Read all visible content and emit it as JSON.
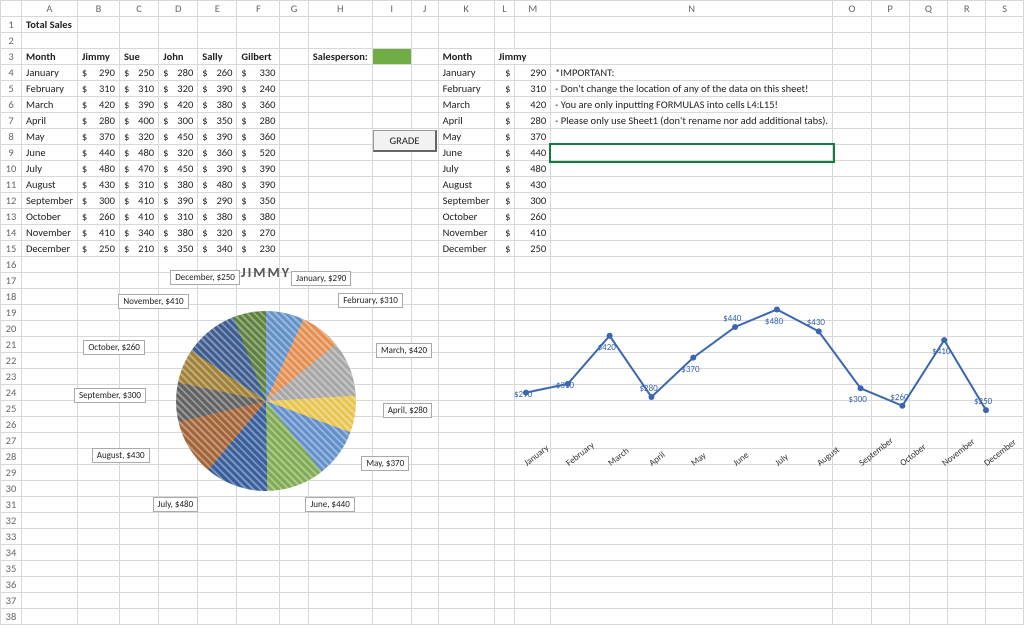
{
  "columns": [
    "A",
    "B",
    "C",
    "D",
    "E",
    "F",
    "G",
    "H",
    "I",
    "J",
    "K",
    "L",
    "M",
    "N",
    "O",
    "P",
    "Q",
    "R",
    "S"
  ],
  "row_count": 38,
  "title_cell": "Total Sales",
  "header_row": {
    "month_label": "Month",
    "people": [
      "Jimmy",
      "Sue",
      "John",
      "Sally",
      "Gilbert"
    ]
  },
  "months": [
    "January",
    "February",
    "March",
    "April",
    "May",
    "June",
    "July",
    "August",
    "September",
    "October",
    "November",
    "December"
  ],
  "sales": {
    "Jimmy": [
      290,
      310,
      420,
      280,
      370,
      440,
      480,
      430,
      300,
      260,
      410,
      250
    ],
    "Sue": [
      250,
      310,
      390,
      400,
      320,
      480,
      470,
      310,
      410,
      410,
      340,
      210
    ],
    "John": [
      280,
      320,
      420,
      300,
      450,
      320,
      450,
      380,
      390,
      310,
      380,
      350
    ],
    "Sally": [
      260,
      390,
      380,
      350,
      390,
      360,
      390,
      480,
      290,
      380,
      320,
      340
    ],
    "Gilbert": [
      330,
      240,
      360,
      280,
      360,
      520,
      390,
      390,
      350,
      380,
      270,
      230
    ]
  },
  "salesperson_label": "Salesperson:",
  "grade_button": "GRADE",
  "right_block": {
    "month_label": "Month",
    "person": "Jimmy",
    "values": [
      290,
      310,
      420,
      280,
      370,
      440,
      480,
      430,
      300,
      260,
      410,
      250
    ]
  },
  "notes": {
    "important": "*IMPORTANT:",
    "line1": "- Don't change the location of any of the data on this sheet!",
    "line2": "- You are only inputting FORMULAS into cells L4:L15!",
    "line3": "- Please only use Sheet1 (don't rename nor add additional tabs)."
  },
  "selected_cell": "N9",
  "chart_data": [
    {
      "type": "pie",
      "title": "JIMMY",
      "categories": [
        "January",
        "February",
        "March",
        "April",
        "May",
        "June",
        "July",
        "August",
        "September",
        "October",
        "November",
        "December"
      ],
      "values": [
        290,
        310,
        420,
        280,
        370,
        440,
        480,
        430,
        300,
        260,
        410,
        250
      ],
      "data_labels": [
        "January, $290",
        "February, $310",
        "March, $420",
        "April, $280",
        "May, $370",
        "June, $440",
        "July, $480",
        "August, $430",
        "September, $300",
        "October, $260",
        "November, $410",
        "December, $250"
      ],
      "colors": [
        "#5b8cc6",
        "#e28a49",
        "#a2a2a2",
        "#e6c246",
        "#5a8ac8",
        "#7aa84a",
        "#2f5597",
        "#9e5c2e",
        "#5a5a5a",
        "#9b7a2c",
        "#33548a",
        "#567a33"
      ]
    },
    {
      "type": "line",
      "title": "",
      "categories": [
        "January",
        "February",
        "March",
        "April",
        "May",
        "June",
        "July",
        "August",
        "September",
        "October",
        "November",
        "December"
      ],
      "series": [
        {
          "name": "Jimmy",
          "values": [
            290,
            310,
            420,
            280,
            370,
            440,
            480,
            430,
            300,
            260,
            410,
            250
          ]
        }
      ],
      "ylim": [
        200,
        520
      ],
      "xlabel": "",
      "ylabel": "",
      "point_labels": [
        "$290",
        "$310",
        "$420",
        "$280",
        "$370",
        "$440",
        "$480",
        "$430",
        "$300",
        "$260",
        "$410",
        "$250"
      ],
      "color": "#3a66b0"
    }
  ]
}
